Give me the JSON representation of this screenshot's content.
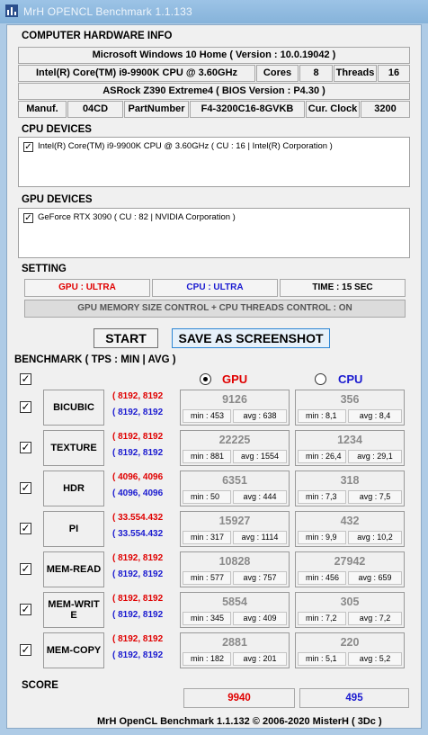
{
  "title": "MrH OPENCL Benchmark 1.1.133",
  "hardware": {
    "section_title": "COMPUTER HARDWARE INFO",
    "os": "Microsoft Windows 10 Home ( Version : 10.0.19042 )",
    "cpu": "Intel(R) Core(TM) i9-9900K CPU @ 3.60GHz",
    "cores_label": "Cores",
    "cores": "8",
    "threads_label": "Threads",
    "threads": "16",
    "board": "ASRock Z390 Extreme4 ( BIOS Version : P4.30 )",
    "manuf_label": "Manuf.",
    "manuf": "04CD",
    "part_label": "PartNumber",
    "part": "F4-3200C16-8GVKB",
    "clock_label": "Cur. Clock",
    "clock": "3200"
  },
  "cpu_devices": {
    "section_title": "CPU DEVICES",
    "items": [
      "Intel(R) Core(TM) i9-9900K CPU @ 3.60GHz ( CU : 16 | Intel(R) Corporation )"
    ]
  },
  "gpu_devices": {
    "section_title": "GPU DEVICES",
    "items": [
      "GeForce RTX 3090 ( CU : 82 | NVIDIA Corporation )"
    ]
  },
  "setting": {
    "section_title": "SETTING",
    "gpu": "GPU : ULTRA",
    "cpu": "CPU : ULTRA",
    "time": "TIME : 15 SEC",
    "memory": "GPU MEMORY SIZE CONTROL + CPU THREADS CONTROL : ON",
    "gpu_color": "#e00000",
    "cpu_color": "#1a1ad0"
  },
  "buttons": {
    "start": "START",
    "save": "SAVE AS SCREENSHOT"
  },
  "benchmark": {
    "section_title": "BENCHMARK ( TPS : MIN | AVG )",
    "gpu_label": "GPU",
    "cpu_label": "CPU",
    "rows": [
      {
        "name": "BICUBIC",
        "gpu_size": "( 8192, 8192",
        "cpu_size": "( 8192, 8192",
        "gpu_val": "9126",
        "gpu_min": "min : 453",
        "gpu_avg": "avg : 638",
        "cpu_val": "356",
        "cpu_min": "min : 8,1",
        "cpu_avg": "avg : 8,4"
      },
      {
        "name": "TEXTURE",
        "gpu_size": "( 8192, 8192",
        "cpu_size": "( 8192, 8192",
        "gpu_val": "22225",
        "gpu_min": "min : 881",
        "gpu_avg": "avg : 1554",
        "cpu_val": "1234",
        "cpu_min": "min : 26,4",
        "cpu_avg": "avg : 29,1"
      },
      {
        "name": "HDR",
        "gpu_size": "( 4096, 4096",
        "cpu_size": "( 4096, 4096",
        "gpu_val": "6351",
        "gpu_min": "min : 50",
        "gpu_avg": "avg : 444",
        "cpu_val": "318",
        "cpu_min": "min : 7,3",
        "cpu_avg": "avg : 7,5"
      },
      {
        "name": "PI",
        "gpu_size": "( 33.554.432",
        "cpu_size": "( 33.554.432",
        "gpu_val": "15927",
        "gpu_min": "min : 317",
        "gpu_avg": "avg : 1114",
        "cpu_val": "432",
        "cpu_min": "min : 9,9",
        "cpu_avg": "avg : 10,2"
      },
      {
        "name": "MEM-READ",
        "gpu_size": "( 8192, 8192",
        "cpu_size": "( 8192, 8192",
        "gpu_val": "10828",
        "gpu_min": "min : 577",
        "gpu_avg": "avg : 757",
        "cpu_val": "27942",
        "cpu_min": "min : 456",
        "cpu_avg": "avg : 659"
      },
      {
        "name": "MEM-WRIT E",
        "gpu_size": "( 8192, 8192",
        "cpu_size": "( 8192, 8192",
        "gpu_val": "5854",
        "gpu_min": "min : 345",
        "gpu_avg": "avg : 409",
        "cpu_val": "305",
        "cpu_min": "min : 7,2",
        "cpu_avg": "avg : 7,2"
      },
      {
        "name": "MEM-COPY",
        "gpu_size": "( 8192, 8192",
        "cpu_size": "( 8192, 8192",
        "gpu_val": "2881",
        "gpu_min": "min : 182",
        "gpu_avg": "avg : 201",
        "cpu_val": "220",
        "cpu_min": "min : 5,1",
        "cpu_avg": "avg : 5,2"
      }
    ]
  },
  "score": {
    "label": "SCORE",
    "gpu": "9940",
    "cpu": "495"
  },
  "footer": "MrH OpenCL Benchmark 1.1.132  ©  2006-2020 MisterH ( 3Dc )"
}
